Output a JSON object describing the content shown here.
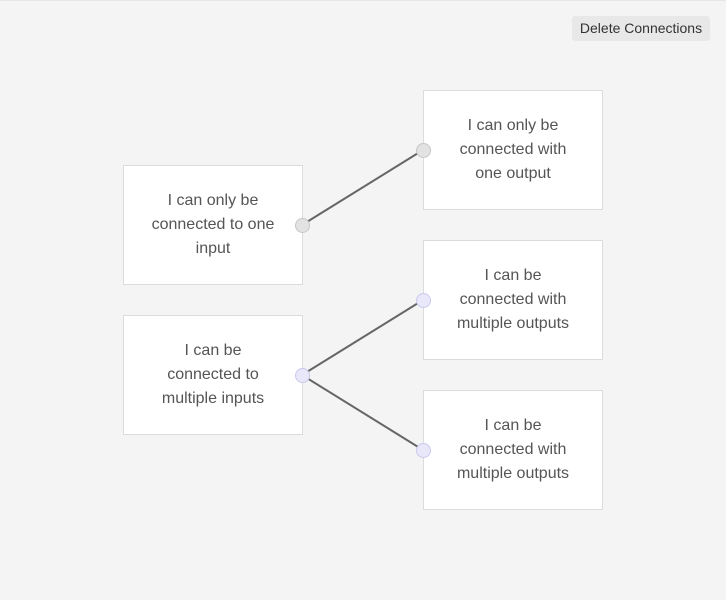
{
  "toolbar": {
    "delete_label": "Delete Connections"
  },
  "nodes": {
    "output_single": "I can only be connected to one input",
    "output_multi": "I can be connected to multiple inputs",
    "input_single": "I can only be connected with one output",
    "input_multi_1": "I can be connected with multiple outputs",
    "input_multi_2": "I can be connected with multiple outputs"
  },
  "connections": [
    {
      "from": "output_single",
      "to": "input_single"
    },
    {
      "from": "output_multi",
      "to": "input_multi_1"
    },
    {
      "from": "output_multi",
      "to": "input_multi_2"
    }
  ],
  "colors": {
    "background": "#f4f4f4",
    "wire": "#666666",
    "single_port": "#e2e2e2",
    "multi_port": "#e8e8fa"
  }
}
